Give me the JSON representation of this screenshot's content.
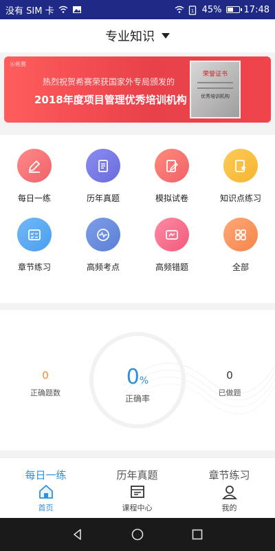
{
  "status_bar": {
    "carrier": "没有 SIM 卡",
    "battery": "45%",
    "battery_level": 0.45,
    "time": "17:48"
  },
  "header": {
    "title": "专业知识"
  },
  "banner": {
    "logo_text": "Ⓐ希赛",
    "line1": "热烈祝贺希赛荣获国家外专局颁发的",
    "line2": "2018年度项目管理优秀培训机构",
    "cert_title": "荣誉证书",
    "cert_sub": "优秀培训机构"
  },
  "grid": {
    "items": [
      {
        "label": "每日一练",
        "icon": "pencil-icon",
        "color": "#f0626a"
      },
      {
        "label": "历年真题",
        "icon": "document-icon",
        "color": "#6a6bdd"
      },
      {
        "label": "模拟试卷",
        "icon": "edit-paper-icon",
        "color": "#f0626a"
      },
      {
        "label": "知识点练习",
        "icon": "star-paper-icon",
        "color": "#f7b531"
      },
      {
        "label": "章节练习",
        "icon": "checklist-icon",
        "color": "#4a9ff0"
      },
      {
        "label": "高频考点",
        "icon": "pulse-icon",
        "color": "#5a7fd6"
      },
      {
        "label": "高频错题",
        "icon": "error-paper-icon",
        "color": "#f25a7b"
      },
      {
        "label": "全部",
        "icon": "grid-icon",
        "color": "#f6854a"
      }
    ]
  },
  "stats": {
    "correct_count": "0",
    "correct_count_label": "正确题数",
    "accuracy": "0",
    "accuracy_unit": "%",
    "accuracy_label": "正确率",
    "done": "0",
    "done_label": "已做题"
  },
  "tabs": [
    "每日一练",
    "历年真题",
    "章节练习"
  ],
  "bottom_nav": [
    {
      "label": "首页",
      "icon": "home-icon",
      "active": true
    },
    {
      "label": "课程中心",
      "icon": "course-icon",
      "active": false
    },
    {
      "label": "我的",
      "icon": "user-icon",
      "active": false
    }
  ],
  "colors": {
    "accent": "#2f8fd8",
    "status_bar": "#1f2a86",
    "banner": "#e8414a"
  }
}
